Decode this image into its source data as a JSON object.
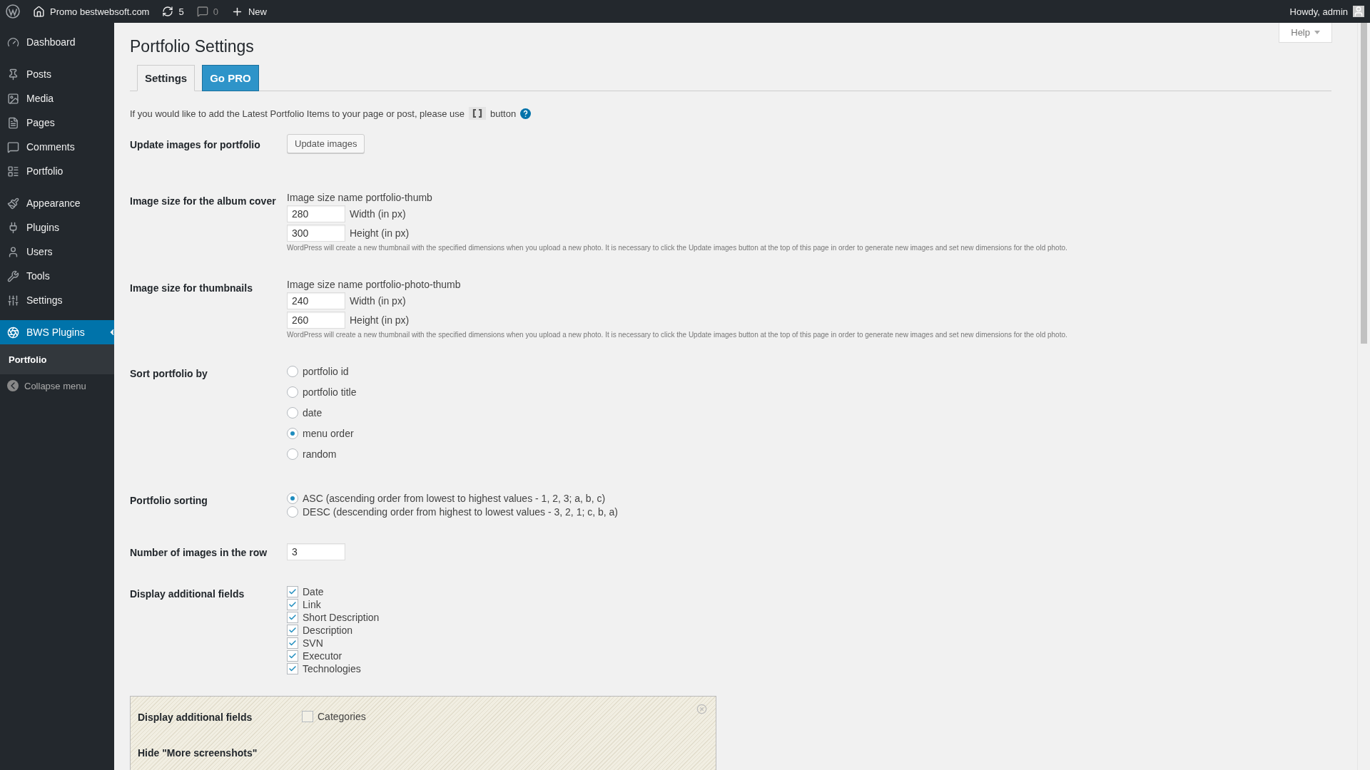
{
  "admin_bar": {
    "site": "Promo bestwebsoft.com",
    "updates": "5",
    "comments": "0",
    "new": "New",
    "greeting": "Howdy, admin"
  },
  "sidebar": {
    "items": [
      {
        "label": "Dashboard",
        "selected": false
      },
      {
        "label": "Posts",
        "selected": false
      },
      {
        "label": "Media",
        "selected": false
      },
      {
        "label": "Pages",
        "selected": false
      },
      {
        "label": "Comments",
        "selected": false
      },
      {
        "label": "Portfolio",
        "selected": false
      },
      {
        "label": "Appearance",
        "selected": false
      },
      {
        "label": "Plugins",
        "selected": false
      },
      {
        "label": "Users",
        "selected": false
      },
      {
        "label": "Tools",
        "selected": false
      },
      {
        "label": "Settings",
        "selected": false
      },
      {
        "label": "BWS Plugins",
        "selected": true
      }
    ],
    "submenu": [
      {
        "label": "Portfolio",
        "selected": true
      }
    ],
    "collapse": "Collapse menu"
  },
  "help": "Help",
  "title": "Portfolio Settings",
  "tabs": [
    {
      "label": "Settings",
      "kind": "plain",
      "selected": true
    },
    {
      "label": "Go PRO",
      "kind": "pro",
      "selected": false
    }
  ],
  "intro": {
    "before": "If you would like to add the Latest Portfolio Items to your page or post, please use",
    "after": "button"
  },
  "rows": [
    {
      "kind": "button",
      "label": "Update images for portfolio",
      "button": "Update images"
    },
    {
      "kind": "size",
      "label": "Image size for the album cover",
      "name_line": "Image size name portfolio-thumb",
      "fields": [
        {
          "value": "280",
          "label": "Width (in px)"
        },
        {
          "value": "300",
          "label": "Height (in px)"
        }
      ],
      "note": "WordPress will create a new thumbnail with the specified dimensions when you upload a new photo. It is necessary to click the Update images button at the top of this page in order to generate new images and set new dimensions for the old photo."
    },
    {
      "kind": "size",
      "label": "Image size for thumbnails",
      "name_line": "Image size name portfolio-photo-thumb",
      "fields": [
        {
          "value": "240",
          "label": "Width (in px)"
        },
        {
          "value": "260",
          "label": "Height (in px)"
        }
      ],
      "note": "WordPress will create a new thumbnail with the specified dimensions when you upload a new photo. It is necessary to click the Update images button at the top of this page in order to generate new images and set new dimensions for the old photo."
    },
    {
      "kind": "radio-list",
      "label": "Sort portfolio by",
      "options": [
        {
          "label": "portfolio id",
          "selected": false
        },
        {
          "label": "portfolio title",
          "selected": false
        },
        {
          "label": "date",
          "selected": false
        },
        {
          "label": "menu order",
          "selected": true
        },
        {
          "label": "random",
          "selected": false
        }
      ]
    },
    {
      "kind": "radio-stack",
      "label": "Portfolio sorting",
      "options": [
        {
          "label": "ASC (ascending order from lowest to highest values - 1, 2, 3; a, b, c)",
          "selected": true
        },
        {
          "label": "DESC (descending order from highest to lowest values - 3, 2, 1; c, b, a)",
          "selected": false
        }
      ]
    },
    {
      "kind": "number",
      "label": "Number of images in the row",
      "value": "3"
    },
    {
      "kind": "checkboxes",
      "label": "Display additional fields",
      "options": [
        {
          "label": "Date",
          "checked": true
        },
        {
          "label": "Link",
          "checked": true
        },
        {
          "label": "Short Description",
          "checked": true
        },
        {
          "label": "Description",
          "checked": true
        },
        {
          "label": "SVN",
          "checked": true
        },
        {
          "label": "Executor",
          "checked": true
        },
        {
          "label": "Technologies",
          "checked": true
        }
      ]
    }
  ],
  "pro_box": {
    "rows": [
      {
        "label": "Display additional fields",
        "options": [
          {
            "label": "Categories",
            "checked": false
          }
        ]
      },
      {
        "label": "Hide \"More screenshots\"",
        "options": []
      }
    ]
  }
}
